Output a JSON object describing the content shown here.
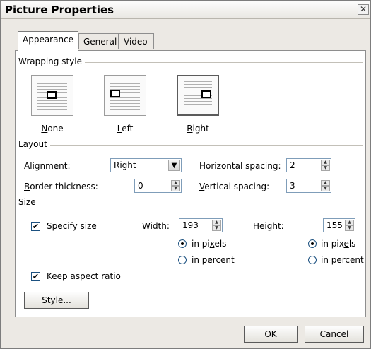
{
  "window": {
    "title": "Picture Properties",
    "close_glyph": "✕"
  },
  "tabs": [
    {
      "label": "Appearance",
      "active": true
    },
    {
      "label": "General",
      "active": false
    },
    {
      "label": "Video",
      "active": false
    }
  ],
  "wrapping": {
    "heading": "Wrapping style",
    "options": [
      {
        "label": "None",
        "mnemonic": "N",
        "rest": "one",
        "selected": false
      },
      {
        "label": "Left",
        "mnemonic": "L",
        "rest": "eft",
        "selected": false
      },
      {
        "label": "Right",
        "mnemonic": "R",
        "rest": "ight",
        "selected": true
      }
    ]
  },
  "layout": {
    "heading": "Layout",
    "alignment_label": {
      "u": "A",
      "rest": "lignment:"
    },
    "alignment_value": "Right",
    "border_label": {
      "u": "B",
      "rest": "order thickness:"
    },
    "border_value": "0",
    "hspacing_label": {
      "pre": "Hori",
      "u": "z",
      "rest": "ontal spacing:"
    },
    "hspacing_value": "2",
    "vspacing_label": {
      "u": "V",
      "rest": "ertical spacing:"
    },
    "vspacing_value": "3"
  },
  "size": {
    "heading": "Size",
    "specify": {
      "pre": "S",
      "u": "p",
      "rest": "ecify size",
      "checked": true
    },
    "width_label": {
      "u": "W",
      "rest": "idth:"
    },
    "width_value": "193",
    "height_label": {
      "u": "H",
      "rest": "eight:"
    },
    "height_value": "155",
    "width_units": {
      "pixels": {
        "pre": "in pi",
        "u": "x",
        "rest": "els",
        "selected": true
      },
      "percent": {
        "pre": "in per",
        "u": "c",
        "rest": "ent",
        "selected": false
      }
    },
    "height_units": {
      "pixels": {
        "pre": "in pix",
        "u": "e",
        "rest": "ls",
        "selected": true
      },
      "percent": {
        "pre": "in percen",
        "u": "t",
        "rest": "",
        "selected": false
      }
    },
    "keep_aspect": {
      "u": "K",
      "rest": "eep aspect ratio",
      "checked": true
    },
    "check_glyph": "✔"
  },
  "style_button": {
    "u": "S",
    "rest": "tyle..."
  },
  "footer": {
    "ok": "OK",
    "cancel": "Cancel"
  },
  "icons": {
    "dropdown": "chevron-down-icon",
    "spin_up": "▲",
    "spin_down": "▼"
  }
}
